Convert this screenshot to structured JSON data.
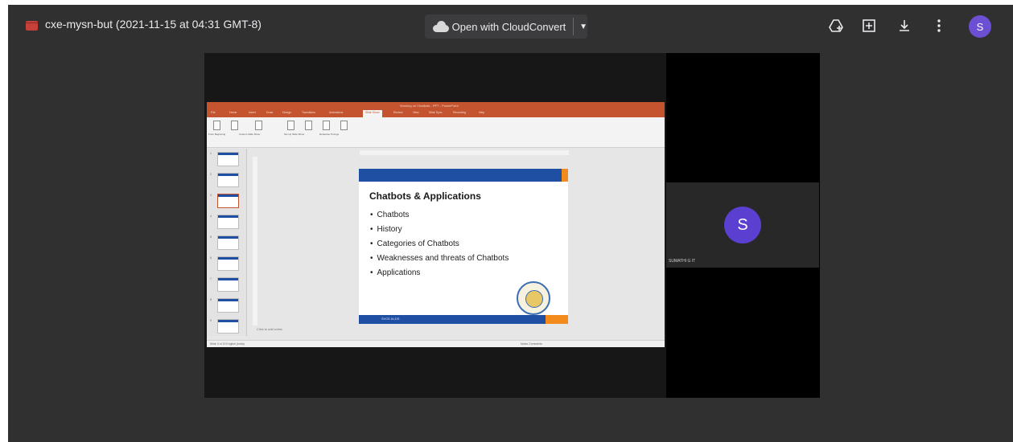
{
  "header": {
    "file_title": "cxe-mysn-but (2021-11-15 at 04:31 GMT-8)",
    "open_with_label": "Open with CloudConvert",
    "avatar_letter": "S"
  },
  "participant": {
    "avatar_letter": "S",
    "name": "SUMATHI G IT"
  },
  "powerpoint": {
    "window_title": "Working on Chatbots - PPT - PowerPoint",
    "tabs": [
      "File",
      "Home",
      "Insert",
      "Draw",
      "Design",
      "Transitions",
      "Animations",
      "Slide Show",
      "Review",
      "View",
      "Slide Sync",
      "Recording",
      "Help"
    ],
    "active_tab": "Slide Show",
    "ribbon_groups": [
      "From Beginning",
      "From Current Slide",
      "Custom Slide Show",
      "Set Up Slide Show",
      "Hide Slide",
      "Rehearse Timings",
      "Record Slide Show"
    ],
    "notes_placeholder": "Click to add notes",
    "status_left": "Slide 3 of 19   English (India)",
    "status_right": "Notes   Comments"
  },
  "slide": {
    "title": "Chatbots & Applications",
    "bullets": [
      "Chatbots",
      "History",
      "Categories of Chatbots",
      "Weaknesses and threats of Chatbots",
      "Applications"
    ],
    "footer_text": "SVCE AI-DS",
    "colors": {
      "primary": "#1f4fa3",
      "accent": "#f28a1c"
    }
  },
  "icons": [
    "video-file-icon",
    "cloud-icon",
    "add-to-drive-icon",
    "open-in-new-window-icon",
    "download-icon",
    "more-vert-icon"
  ]
}
